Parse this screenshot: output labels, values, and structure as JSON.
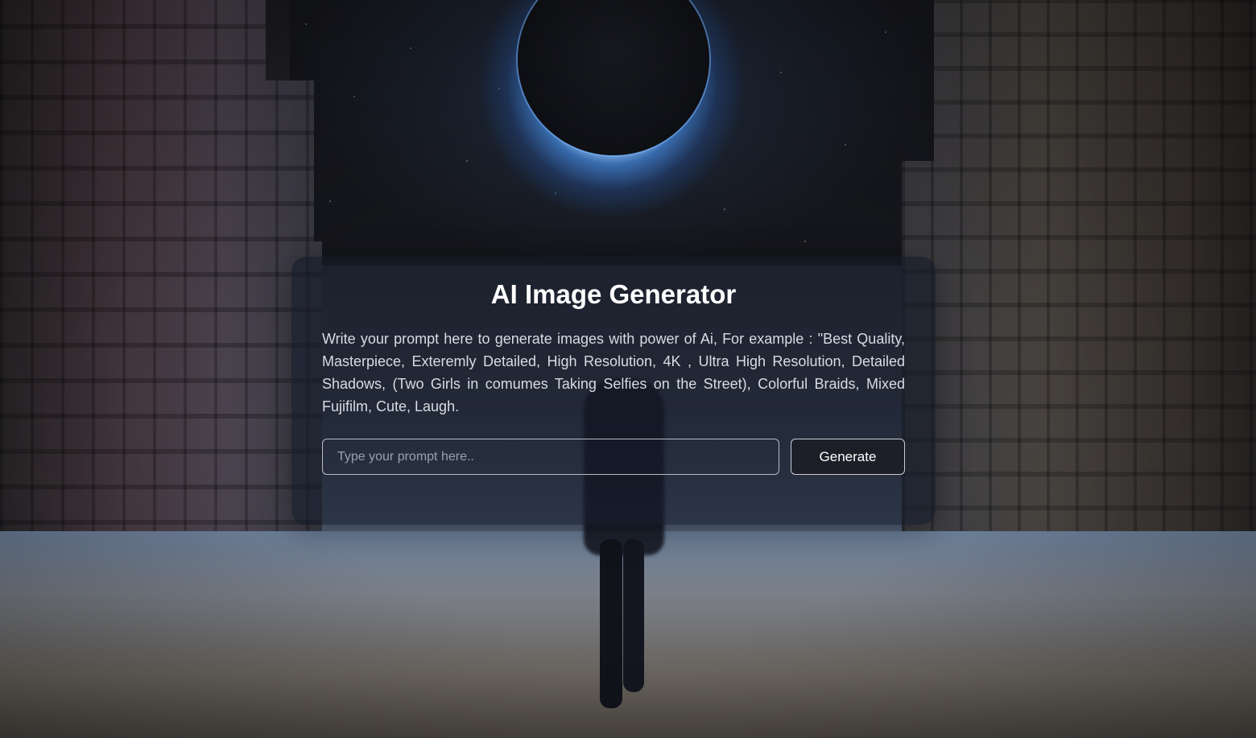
{
  "card": {
    "title": "AI Image Generator",
    "description": "Write your prompt here to generate images with power of Ai, For example : \"Best Quality, Masterpiece, Exteremly Detailed, High Resolution, 4K , Ultra High Resolution, Detailed Shadows, (Two Girls in comumes Taking Selfies on the Street), Colorful Braids, Mixed Fujifilm, Cute, Laugh.",
    "prompt_placeholder": "Type your prompt here..",
    "prompt_value": "",
    "generate_label": "Generate"
  },
  "colors": {
    "card_background": "#141a28",
    "accent_glow": "#6aa8f0",
    "button_background": "#1c1f27"
  }
}
